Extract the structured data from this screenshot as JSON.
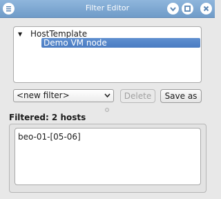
{
  "window": {
    "title": "Filter Editor"
  },
  "tree": {
    "root_label": "HostTemplate",
    "expander": "▼",
    "children": [
      {
        "label": "Demo VM node",
        "selected": true
      }
    ]
  },
  "controls": {
    "filter_select_value": "<new filter>",
    "delete_label": "Delete",
    "delete_enabled": false,
    "save_as_label": "Save as"
  },
  "results": {
    "heading": "Filtered: 2 hosts",
    "hosts_text": "beo-01-[05-06]"
  },
  "colors": {
    "titlebar": "#7ea8d4",
    "selection": "#5585c8"
  }
}
